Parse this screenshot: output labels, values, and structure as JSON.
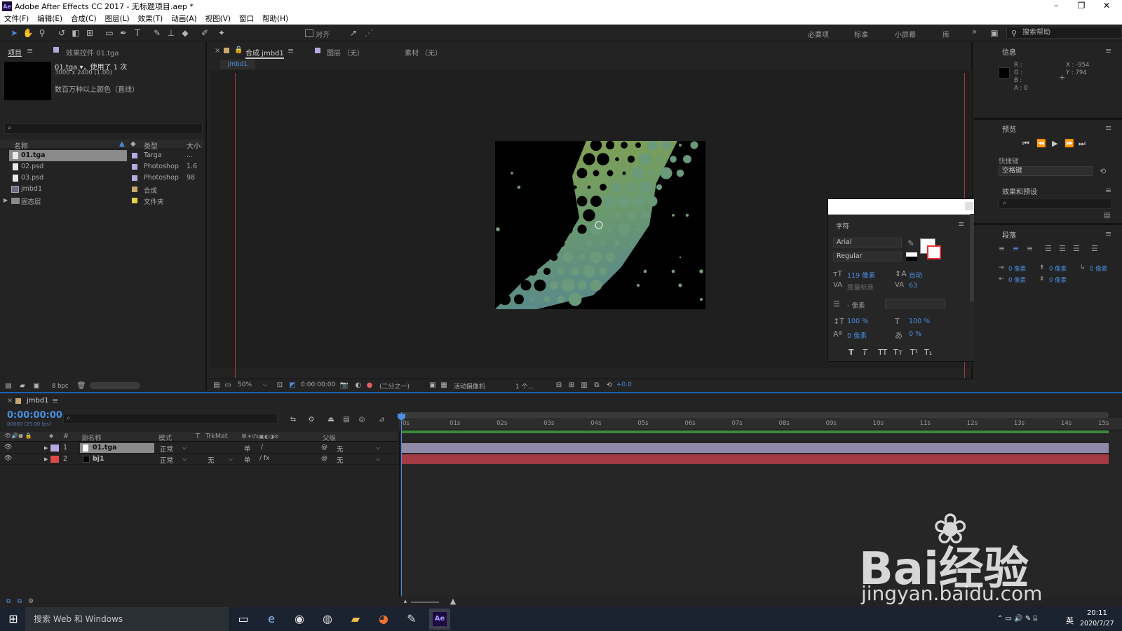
{
  "window": {
    "title": "Adobe After Effects CC 2017 - 无标题项目.aep *",
    "logo_text": "Ae",
    "minimize": "–",
    "maximize": "❐",
    "close": "✕"
  },
  "menu": [
    "文件(F)",
    "编辑(E)",
    "合成(C)",
    "图层(L)",
    "效果(T)",
    "动画(A)",
    "视图(V)",
    "窗口",
    "帮助(H)"
  ],
  "toolbar": {
    "align_label": "对齐",
    "workspaces": [
      "必要项",
      "标准",
      "小屏幕",
      "库"
    ],
    "overflow": "»",
    "help_search_placeholder": "搜索帮助"
  },
  "project": {
    "tab_project": "项目",
    "tab_effects": "效果控件 01.tga",
    "selected_name": "01.tga ▾，使用了 1 次",
    "dimensions": "3000 x 2400 (1.00)",
    "color_depth": "数百万种以上颜色（直线）",
    "search_icon": "⌕",
    "columns": {
      "name": "名称",
      "type": "类型",
      "size": "大小"
    },
    "items": [
      {
        "name": "01.tga",
        "type": "Targa",
        "size": "...",
        "swatch": "#b8a8e0",
        "selected": true
      },
      {
        "name": "02.psd",
        "type": "Photoshop",
        "size": "1.6",
        "swatch": "#b8a8e0"
      },
      {
        "name": "03.psd",
        "type": "Photoshop",
        "size": "98",
        "swatch": "#b8a8e0"
      },
      {
        "name": "jmbd1",
        "type": "合成",
        "size": "",
        "swatch": "#c8a870"
      },
      {
        "name": "固态层",
        "type": "文件夹",
        "size": "",
        "swatch": "#e8d048"
      }
    ],
    "bpc": "8 bpc"
  },
  "viewer": {
    "tab_comp": "合成 jmbd1",
    "tab_layer": "图层 （无）",
    "tab_footage": "素材 （无）",
    "comp_chip": "jmbd1",
    "zoom": "50%",
    "timecode": "0:00:00:00",
    "resolution": "(二分之一)",
    "camera": "活动摄像机",
    "views": "1 个...",
    "exposure": "+0.0"
  },
  "character": {
    "title": "字符",
    "font": "Arial",
    "style": "Regular",
    "font_size": "119 像素",
    "leading": "自动",
    "kerning": "度量标准",
    "tracking": "63",
    "stroke_width": "- 像素",
    "vscale": "100 %",
    "hscale": "100 %",
    "baseline": "0 像素",
    "tsume": "0 %",
    "styles": [
      "T",
      "T",
      "TT",
      "Tт",
      "T¹",
      "T₁"
    ]
  },
  "info": {
    "title": "信息",
    "r": "R :",
    "g": "G :",
    "b": "B :",
    "a": "A : 0",
    "x": "X : -954",
    "y": "Y : 794"
  },
  "preview": {
    "title": "预览",
    "shortcut_label": "快捷键",
    "shortcut_value": "空格键"
  },
  "effects": {
    "title": "效果和预设",
    "search_icon": "⌕"
  },
  "paragraph": {
    "title": "段落",
    "indent_values": [
      "0 像素",
      "0 像素",
      "0 像素",
      "0 像素",
      "0 像素"
    ]
  },
  "timeline": {
    "tab": "jmbd1",
    "timecode": "0:00:00:00",
    "fps": "00000 (25.00 fps)",
    "columns": {
      "num": "#",
      "source": "源名称",
      "mode": "模式",
      "t": "T",
      "trkmat": "TrkMat",
      "parent": "父级"
    },
    "ruler": [
      "0s",
      "01s",
      "02s",
      "03s",
      "04s",
      "05s",
      "06s",
      "07s",
      "08s",
      "09s",
      "10s",
      "11s",
      "12s",
      "13s",
      "14s",
      "15s"
    ],
    "layers": [
      {
        "num": "1",
        "name": "01.tga",
        "mode": "正常",
        "trkmat": "",
        "parent": "无",
        "color": "#b8a8e0",
        "bar": "#8f8aa8"
      },
      {
        "num": "2",
        "name": "bj1",
        "mode": "正常",
        "trkmat": "无",
        "parent": "无",
        "color": "#e04848",
        "bar": "#a33a44"
      }
    ]
  },
  "taskbar": {
    "search": "搜索 Web 和 Windows",
    "time": "20:11",
    "date": "2020/7/27",
    "ime": "英"
  },
  "watermark": {
    "main": "Bai经验",
    "sub": "jingyan.baidu.com"
  }
}
